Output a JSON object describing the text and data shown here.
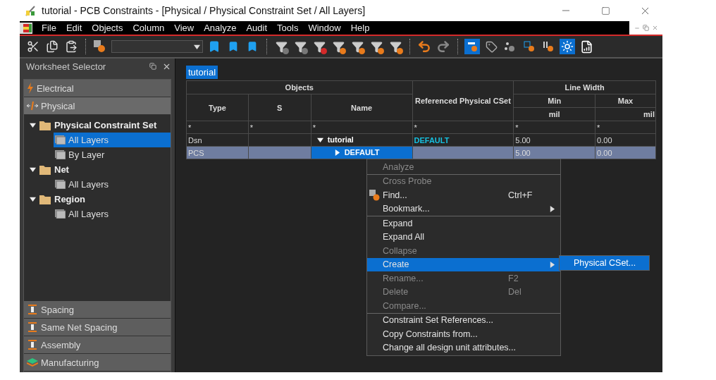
{
  "window": {
    "title": "tutorial - PCB Constraints - [Physical / Physical Constraint Set / All Layers]"
  },
  "menu": [
    "File",
    "Edit",
    "Objects",
    "Column",
    "View",
    "Analyze",
    "Audit",
    "Tools",
    "Window",
    "Help"
  ],
  "worksheet_selector": {
    "title": "Worksheet Selector",
    "top_categories": [
      {
        "label": "Electrical",
        "selected": false
      },
      {
        "label": "Physical",
        "selected": true
      }
    ],
    "tree": [
      {
        "label": "Physical Constraint Set",
        "expanded": true,
        "children": [
          {
            "label": "All Layers",
            "selected": true
          },
          {
            "label": "By Layer",
            "selected": false
          }
        ]
      },
      {
        "label": "Net",
        "expanded": true,
        "children": [
          {
            "label": "All Layers",
            "selected": false
          }
        ]
      },
      {
        "label": "Region",
        "expanded": true,
        "children": [
          {
            "label": "All Layers",
            "selected": false
          }
        ]
      }
    ],
    "bottom_categories": [
      {
        "label": "Spacing",
        "selected": false
      },
      {
        "label": "Same Net Spacing",
        "selected": false
      },
      {
        "label": "Assembly",
        "selected": false
      },
      {
        "label": "Manufacturing",
        "selected": false
      }
    ]
  },
  "tabs": [
    {
      "label": "tutorial",
      "selected": true
    }
  ],
  "table": {
    "groups": [
      "Objects",
      "Line Width"
    ],
    "columns": [
      "Type",
      "S",
      "Name",
      "Referenced Physical CSet",
      "Min",
      "Max"
    ],
    "units": [
      "mil",
      "mil"
    ],
    "filter": [
      "*",
      "*",
      "*",
      "*",
      "*",
      "*"
    ],
    "rows": [
      {
        "cells": [
          "Dsn",
          "",
          "tutorial",
          "DEFAULT",
          "5.00",
          "0.00"
        ],
        "expanded": true,
        "selected": false
      },
      {
        "cells": [
          "PCS",
          "",
          "DEFAULT",
          "",
          "5.00",
          "0.00"
        ],
        "expanded": false,
        "selected": true
      }
    ]
  },
  "context_menu": {
    "groups": [
      [
        {
          "label": "Analyze",
          "disabled": true,
          "submenu": false,
          "selected": false
        }
      ],
      [
        {
          "label": "Cross Probe",
          "disabled": true,
          "submenu": false,
          "selected": false
        },
        {
          "label": "Find...",
          "shortcut": "Ctrl+F",
          "disabled": false,
          "submenu": false,
          "selected": false,
          "has_icon": true
        },
        {
          "label": "Bookmark...",
          "disabled": false,
          "submenu": true,
          "selected": false
        }
      ],
      [
        {
          "label": "Expand",
          "disabled": false,
          "submenu": false,
          "selected": false
        },
        {
          "label": "Expand All",
          "disabled": false,
          "submenu": false,
          "selected": false
        },
        {
          "label": "Collapse",
          "disabled": true,
          "submenu": false,
          "selected": false
        },
        {
          "label": "Create",
          "disabled": false,
          "submenu": true,
          "selected": true
        },
        {
          "label": "Rename...",
          "shortcut": "F2",
          "disabled": true,
          "submenu": false,
          "selected": false
        },
        {
          "label": "Delete",
          "shortcut": "Del",
          "disabled": true,
          "submenu": false,
          "selected": false
        },
        {
          "label": "Compare...",
          "disabled": true,
          "submenu": false,
          "selected": false
        }
      ],
      [
        {
          "label": "Constraint Set References...",
          "disabled": false,
          "submenu": false,
          "selected": false
        },
        {
          "label": "Copy Constraints from...",
          "disabled": false,
          "submenu": false,
          "selected": false
        },
        {
          "label": "Change all design unit attributes...",
          "disabled": false,
          "submenu": false,
          "selected": false
        }
      ]
    ],
    "submenu": [
      {
        "label": "Physical CSet...",
        "selected": true
      }
    ]
  }
}
